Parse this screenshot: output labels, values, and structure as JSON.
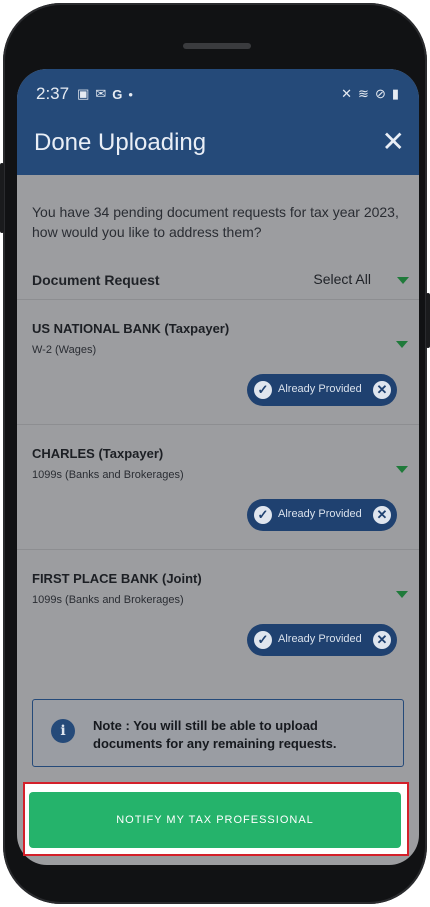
{
  "status_bar": {
    "time": "2:37",
    "left_icons": [
      "image-icon",
      "mail-icon",
      "google-icon",
      "dot-icon"
    ],
    "right_icons": [
      "mute-icon",
      "wifi-icon",
      "dnd-icon",
      "battery-icon"
    ]
  },
  "header": {
    "title": "Done Uploading",
    "close_icon": "close-icon"
  },
  "intro": "You have 34 pending document requests for tax year 2023, how would you like to address them?",
  "list_header": {
    "label": "Document Request",
    "select_all": "Select All"
  },
  "requests": [
    {
      "name": "US NATIONAL BANK (Taxpayer)",
      "type": "W-2 (Wages)",
      "status": "Already Provided"
    },
    {
      "name": "CHARLES  (Taxpayer)",
      "type": "1099s (Banks and Brokerages)",
      "status": "Already Provided"
    },
    {
      "name": "FIRST PLACE BANK  (Joint)",
      "type": "1099s (Banks and Brokerages)",
      "status": "Already Provided"
    }
  ],
  "note": "Note : You will still be able to upload documents for any remaining requests.",
  "primary_button": "NOTIFY MY TAX PROFESSIONAL",
  "colors": {
    "header_bg": "#254a79",
    "overlay": "#9c9da0",
    "badge_bg": "#1f4170",
    "button_bg": "#25b36b",
    "highlight_border": "#d4202a",
    "dropdown_arrow": "#1f7a3a"
  }
}
